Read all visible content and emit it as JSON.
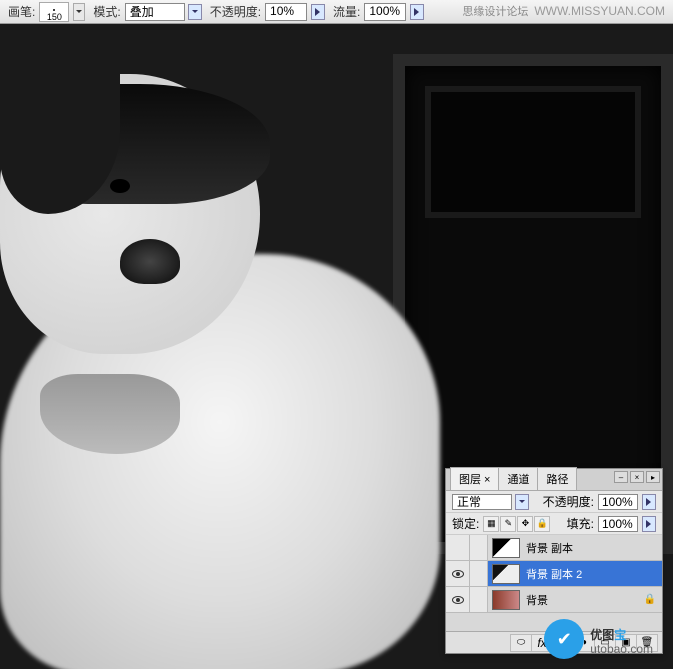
{
  "toolbar": {
    "brush_label": "画笔:",
    "brush_size": "150",
    "mode_label": "模式:",
    "mode_value": "叠加",
    "opacity_label": "不透明度:",
    "opacity_value": "10%",
    "flow_label": "流量:",
    "flow_value": "100%"
  },
  "watermark_top": {
    "text": "思缘设计论坛",
    "url": "WWW.MISSYUAN.COM"
  },
  "layers_panel": {
    "tabs": [
      "图层 ×",
      "通道",
      "路径"
    ],
    "blend_mode": "正常",
    "opacity_label": "不透明度:",
    "opacity_value": "100%",
    "lock_label": "锁定:",
    "fill_label": "填充:",
    "fill_value": "100%",
    "layers": [
      {
        "name": "背景 副本",
        "visible": false,
        "thumb": "bw",
        "selected": false
      },
      {
        "name": "背景 副本 2",
        "visible": true,
        "thumb": "bw2",
        "selected": true
      },
      {
        "name": "背景",
        "visible": true,
        "thumb": "color",
        "selected": false,
        "locked": true
      }
    ]
  },
  "watermark_bottom": {
    "title_a": "优图",
    "title_b": "宝",
    "url": "utobao.com"
  }
}
